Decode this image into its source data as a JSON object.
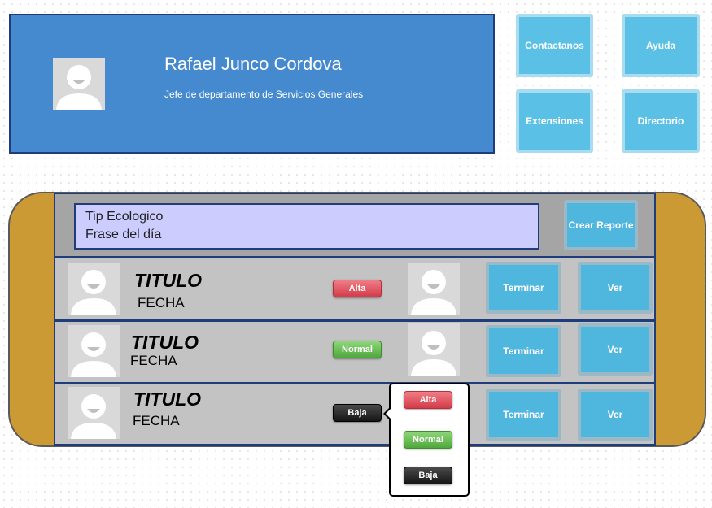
{
  "profile": {
    "name": "Rafael Junco Cordova",
    "role": "Jefe de departamento de Servicios Generales",
    "avatar_icon": "user-avatar-icon"
  },
  "nav_buttons": {
    "contactanos": "Contactanos",
    "ayuda": "Ayuda",
    "extensiones": "Extensiones",
    "directorio": "Directorio"
  },
  "tip": {
    "line1": "Tip Ecologico",
    "line2": "Frase del día"
  },
  "create_report_label": "Crear Reporte",
  "reports": [
    {
      "title": "TITULO",
      "date": "FECHA",
      "priority": "Alta",
      "finish_label": "Terminar",
      "view_label": "Ver"
    },
    {
      "title": "TITULO",
      "date": "FECHA",
      "priority": "Normal",
      "finish_label": "Terminar",
      "view_label": "Ver"
    },
    {
      "title": "TITULO",
      "date": "FECHA",
      "priority": "Baja",
      "finish_label": "Terminar",
      "view_label": "Ver"
    }
  ],
  "priority_menu": {
    "options": [
      "Alta",
      "Normal",
      "Baja"
    ]
  },
  "colors": {
    "profile_bg": "#4589ce",
    "button_bg": "#5bc0e6",
    "frame_bg": "#cc9a35",
    "tip_bg": "#ccccff",
    "alta": "#d43b49",
    "normal": "#4fa83b",
    "baja": "#161616"
  }
}
